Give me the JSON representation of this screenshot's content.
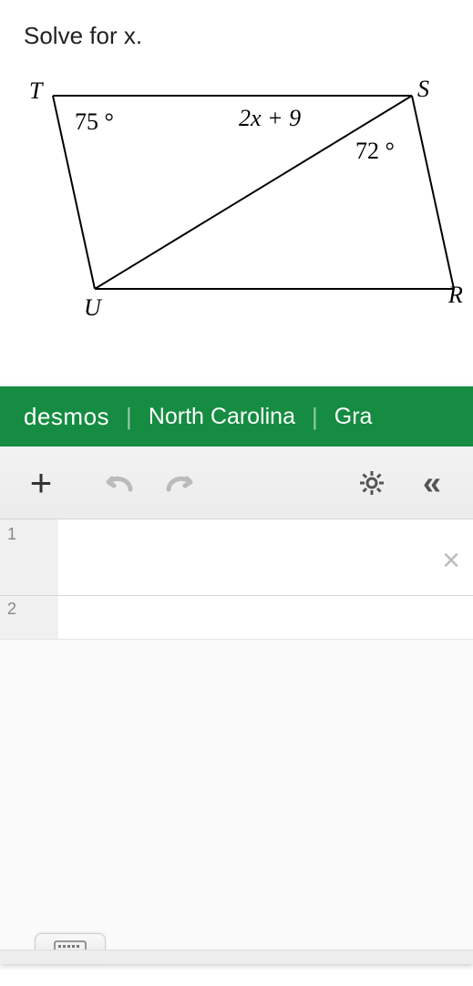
{
  "problem": {
    "title": "Solve for x.",
    "vertices": {
      "T": "T",
      "S": "S",
      "U": "U",
      "R": "R"
    },
    "angleT": "75 °",
    "exprSU": "2x + 9",
    "angleS": "72 °"
  },
  "calculator": {
    "brand_html": "desmos",
    "state": "North Carolina",
    "tail": "Gra",
    "rows": [
      {
        "num": "1",
        "value": ""
      },
      {
        "num": "2",
        "value": ""
      }
    ],
    "icons": {
      "plus": "+",
      "undo": "undo-icon",
      "redo": "redo-icon",
      "gear": "gear-icon",
      "collapse": "«",
      "close": "×",
      "keyboard": "keyboard-icon"
    }
  },
  "chart_data": {
    "type": "table",
    "note": "Geometry figure: parallelogram TSUR with diagonal SU",
    "angles_deg": {
      "T": 75,
      "S_upper_right": 72
    },
    "diagonal_label": "2x + 9"
  }
}
